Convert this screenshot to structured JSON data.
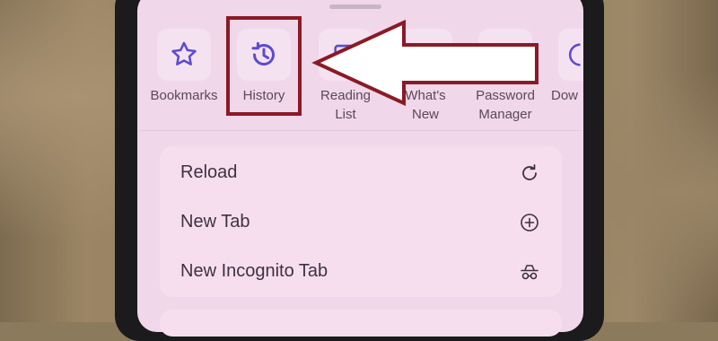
{
  "toolbar": {
    "items": [
      {
        "label": "Bookmarks",
        "icon": "star-icon"
      },
      {
        "label": "History",
        "icon": "history-clock-icon"
      },
      {
        "label_line1": "Reading",
        "label_line2": "List",
        "icon": "reading-list-icon"
      },
      {
        "label_line1": "What's",
        "label_line2": "New",
        "icon": "whats-new-icon"
      },
      {
        "label_line1": "Password",
        "label_line2": "Manager",
        "icon": "password-manager-icon"
      },
      {
        "label": "Dow",
        "icon": "downloads-icon"
      }
    ]
  },
  "menu": {
    "items": [
      {
        "label": "Reload",
        "icon": "reload-icon"
      },
      {
        "label": "New Tab",
        "icon": "plus-circle-icon"
      },
      {
        "label": "New Incognito Tab",
        "icon": "incognito-icon"
      }
    ]
  },
  "colors": {
    "accent": "#5b4bd1",
    "annotation": "#8b1a24",
    "sheet_background": "#f1d7ea"
  }
}
